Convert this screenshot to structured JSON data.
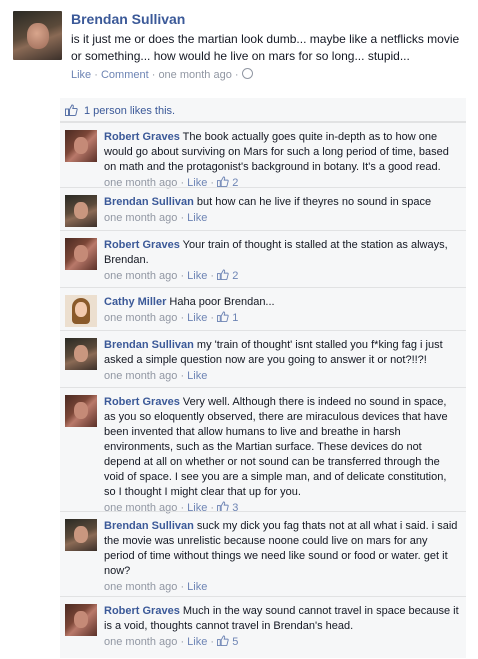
{
  "post": {
    "author": "Brendan Sullivan",
    "text": "is it just me or does the martian look dumb... maybe like a netflicks movie or something... how would he live on mars for so long... stupid...",
    "actions": {
      "like": "Like",
      "comment": "Comment",
      "time": "one month ago"
    }
  },
  "likes_summary": "1 person likes this.",
  "comments": [
    {
      "author": "Robert Graves",
      "text": "The book actually goes quite in-depth as to how one would go about surviving on Mars for such a long period of time, based on math and the protagonist's background in botany. It's a good read.",
      "time": "one month ago",
      "like": "Like",
      "likes": "2"
    },
    {
      "author": "Brendan Sullivan",
      "text": "but how can he live if theyres no sound in space",
      "time": "one month ago",
      "like": "Like",
      "likes": ""
    },
    {
      "author": "Robert Graves",
      "text": "Your train of thought is stalled at the station as always, Brendan.",
      "time": "one month ago",
      "like": "Like",
      "likes": "2"
    },
    {
      "author": "Cathy Miller",
      "text": "Haha poor Brendan...",
      "time": "one month ago",
      "like": "Like",
      "likes": "1"
    },
    {
      "author": "Brendan Sullivan",
      "text": "my 'train of thought' isnt stalled you f*king fag i just asked a simple question now are you going to answer it or not?!!?!",
      "time": "one month ago",
      "like": "Like",
      "likes": ""
    },
    {
      "author": "Robert Graves",
      "text": "Very well. Although there is indeed no sound in space, as you so eloquently observed, there are miraculous devices that have been invented that allow humans to live and breathe in harsh environments, such as the Martian surface. These devices do not depend at all on whether or not sound can be transferred through the void of space. I see you are a simple man, and of delicate constitution, so I thought I might clear that up for you.",
      "time": "one month ago",
      "like": "Like",
      "likes": "3"
    },
    {
      "author": "Brendan Sullivan",
      "text": "suck my dick you fag thats not at all what i said. i said the movie was unrelistic because noone could live on mars for any period of time without things we need like sound or food or water. get it now?",
      "time": "one month ago",
      "like": "Like",
      "likes": ""
    },
    {
      "author": "Robert Graves",
      "text": "Much in the way sound cannot travel in space because it is a void, thoughts cannot travel in Brendan's head.",
      "time": "one month ago",
      "like": "Like",
      "likes": "5"
    }
  ],
  "colors": {
    "link": "#3b5998",
    "meta": "#9197a3",
    "ufi_bg": "#f6f7f8"
  },
  "icons": {
    "thumbs_up": "thumbs-up-icon",
    "globe": "globe-icon"
  }
}
